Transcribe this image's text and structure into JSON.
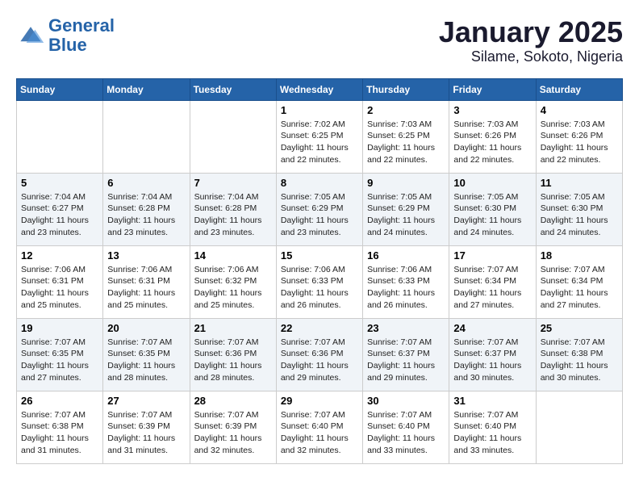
{
  "header": {
    "logo_line1": "General",
    "logo_line2": "Blue",
    "title": "January 2025",
    "subtitle": "Silame, Sokoto, Nigeria"
  },
  "days_of_week": [
    "Sunday",
    "Monday",
    "Tuesday",
    "Wednesday",
    "Thursday",
    "Friday",
    "Saturday"
  ],
  "weeks": [
    {
      "cells": [
        {
          "day": null,
          "info": null
        },
        {
          "day": null,
          "info": null
        },
        {
          "day": null,
          "info": null
        },
        {
          "day": "1",
          "info": "Sunrise: 7:02 AM\nSunset: 6:25 PM\nDaylight: 11 hours\nand 22 minutes."
        },
        {
          "day": "2",
          "info": "Sunrise: 7:03 AM\nSunset: 6:25 PM\nDaylight: 11 hours\nand 22 minutes."
        },
        {
          "day": "3",
          "info": "Sunrise: 7:03 AM\nSunset: 6:26 PM\nDaylight: 11 hours\nand 22 minutes."
        },
        {
          "day": "4",
          "info": "Sunrise: 7:03 AM\nSunset: 6:26 PM\nDaylight: 11 hours\nand 22 minutes."
        }
      ]
    },
    {
      "cells": [
        {
          "day": "5",
          "info": "Sunrise: 7:04 AM\nSunset: 6:27 PM\nDaylight: 11 hours\nand 23 minutes."
        },
        {
          "day": "6",
          "info": "Sunrise: 7:04 AM\nSunset: 6:28 PM\nDaylight: 11 hours\nand 23 minutes."
        },
        {
          "day": "7",
          "info": "Sunrise: 7:04 AM\nSunset: 6:28 PM\nDaylight: 11 hours\nand 23 minutes."
        },
        {
          "day": "8",
          "info": "Sunrise: 7:05 AM\nSunset: 6:29 PM\nDaylight: 11 hours\nand 23 minutes."
        },
        {
          "day": "9",
          "info": "Sunrise: 7:05 AM\nSunset: 6:29 PM\nDaylight: 11 hours\nand 24 minutes."
        },
        {
          "day": "10",
          "info": "Sunrise: 7:05 AM\nSunset: 6:30 PM\nDaylight: 11 hours\nand 24 minutes."
        },
        {
          "day": "11",
          "info": "Sunrise: 7:05 AM\nSunset: 6:30 PM\nDaylight: 11 hours\nand 24 minutes."
        }
      ]
    },
    {
      "cells": [
        {
          "day": "12",
          "info": "Sunrise: 7:06 AM\nSunset: 6:31 PM\nDaylight: 11 hours\nand 25 minutes."
        },
        {
          "day": "13",
          "info": "Sunrise: 7:06 AM\nSunset: 6:31 PM\nDaylight: 11 hours\nand 25 minutes."
        },
        {
          "day": "14",
          "info": "Sunrise: 7:06 AM\nSunset: 6:32 PM\nDaylight: 11 hours\nand 25 minutes."
        },
        {
          "day": "15",
          "info": "Sunrise: 7:06 AM\nSunset: 6:33 PM\nDaylight: 11 hours\nand 26 minutes."
        },
        {
          "day": "16",
          "info": "Sunrise: 7:06 AM\nSunset: 6:33 PM\nDaylight: 11 hours\nand 26 minutes."
        },
        {
          "day": "17",
          "info": "Sunrise: 7:07 AM\nSunset: 6:34 PM\nDaylight: 11 hours\nand 27 minutes."
        },
        {
          "day": "18",
          "info": "Sunrise: 7:07 AM\nSunset: 6:34 PM\nDaylight: 11 hours\nand 27 minutes."
        }
      ]
    },
    {
      "cells": [
        {
          "day": "19",
          "info": "Sunrise: 7:07 AM\nSunset: 6:35 PM\nDaylight: 11 hours\nand 27 minutes."
        },
        {
          "day": "20",
          "info": "Sunrise: 7:07 AM\nSunset: 6:35 PM\nDaylight: 11 hours\nand 28 minutes."
        },
        {
          "day": "21",
          "info": "Sunrise: 7:07 AM\nSunset: 6:36 PM\nDaylight: 11 hours\nand 28 minutes."
        },
        {
          "day": "22",
          "info": "Sunrise: 7:07 AM\nSunset: 6:36 PM\nDaylight: 11 hours\nand 29 minutes."
        },
        {
          "day": "23",
          "info": "Sunrise: 7:07 AM\nSunset: 6:37 PM\nDaylight: 11 hours\nand 29 minutes."
        },
        {
          "day": "24",
          "info": "Sunrise: 7:07 AM\nSunset: 6:37 PM\nDaylight: 11 hours\nand 30 minutes."
        },
        {
          "day": "25",
          "info": "Sunrise: 7:07 AM\nSunset: 6:38 PM\nDaylight: 11 hours\nand 30 minutes."
        }
      ]
    },
    {
      "cells": [
        {
          "day": "26",
          "info": "Sunrise: 7:07 AM\nSunset: 6:38 PM\nDaylight: 11 hours\nand 31 minutes."
        },
        {
          "day": "27",
          "info": "Sunrise: 7:07 AM\nSunset: 6:39 PM\nDaylight: 11 hours\nand 31 minutes."
        },
        {
          "day": "28",
          "info": "Sunrise: 7:07 AM\nSunset: 6:39 PM\nDaylight: 11 hours\nand 32 minutes."
        },
        {
          "day": "29",
          "info": "Sunrise: 7:07 AM\nSunset: 6:40 PM\nDaylight: 11 hours\nand 32 minutes."
        },
        {
          "day": "30",
          "info": "Sunrise: 7:07 AM\nSunset: 6:40 PM\nDaylight: 11 hours\nand 33 minutes."
        },
        {
          "day": "31",
          "info": "Sunrise: 7:07 AM\nSunset: 6:40 PM\nDaylight: 11 hours\nand 33 minutes."
        },
        {
          "day": null,
          "info": null
        }
      ]
    }
  ]
}
